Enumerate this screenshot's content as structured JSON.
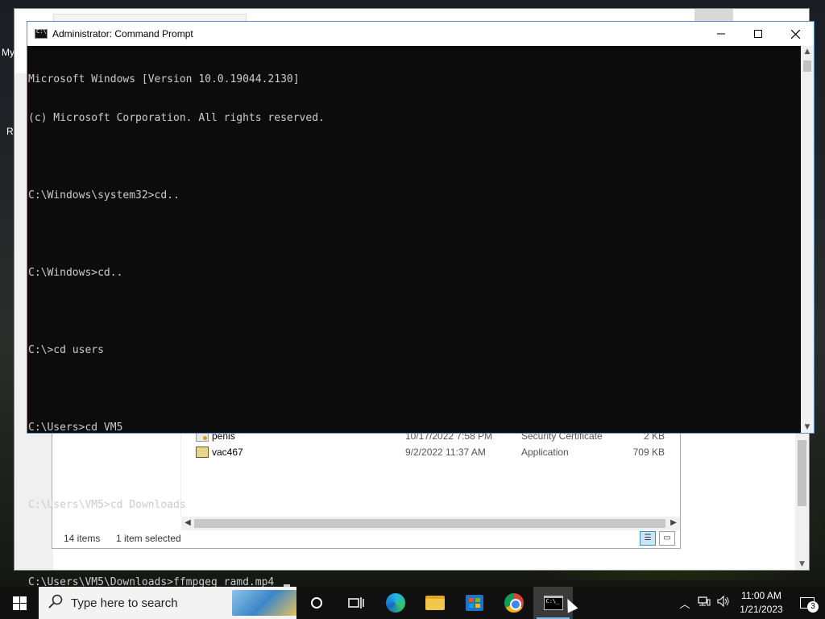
{
  "desktop": {
    "label_1": "My",
    "label_2": "Re"
  },
  "cmd_window": {
    "title": "Administrator:  Command Prompt",
    "controls": {
      "minimize": "—",
      "maximize": "☐",
      "close": "✕"
    },
    "lines": [
      "Microsoft Windows [Version 10.0.19044.2130]",
      "(c) Microsoft Corporation. All rights reserved.",
      "",
      "C:\\Windows\\system32>cd..",
      "",
      "C:\\Windows>cd..",
      "",
      "C:\\>cd users",
      "",
      "C:\\Users>cd VM5",
      "",
      "C:\\Users\\VM5>cd Downloads",
      "",
      "C:\\Users\\VM5\\Downloads>ffmpgeg ramd.mp4 "
    ]
  },
  "explorer": {
    "files": [
      {
        "name": "penis",
        "date": "10/17/2022 7:58 PM",
        "type": "Security Certificate",
        "size": "2 KB",
        "icon": "certificate-icon"
      },
      {
        "name": "vac467",
        "date": "9/2/2022 11:37 AM",
        "type": "Application",
        "size": "709 KB",
        "icon": "application-icon"
      }
    ],
    "status": {
      "item_count": "14 items",
      "selected": "1 item selected"
    }
  },
  "taskbar": {
    "search_placeholder": "Type here to search",
    "apps": [
      "cortana-icon",
      "task-view-icon",
      "edge-icon",
      "file-explorer-icon",
      "store-icon",
      "chrome-icon",
      "command-prompt-icon"
    ],
    "clock": {
      "time": "11:00 AM",
      "date": "1/21/2023"
    },
    "notification_count": "3",
    "accent_color": "#76b9ed"
  }
}
